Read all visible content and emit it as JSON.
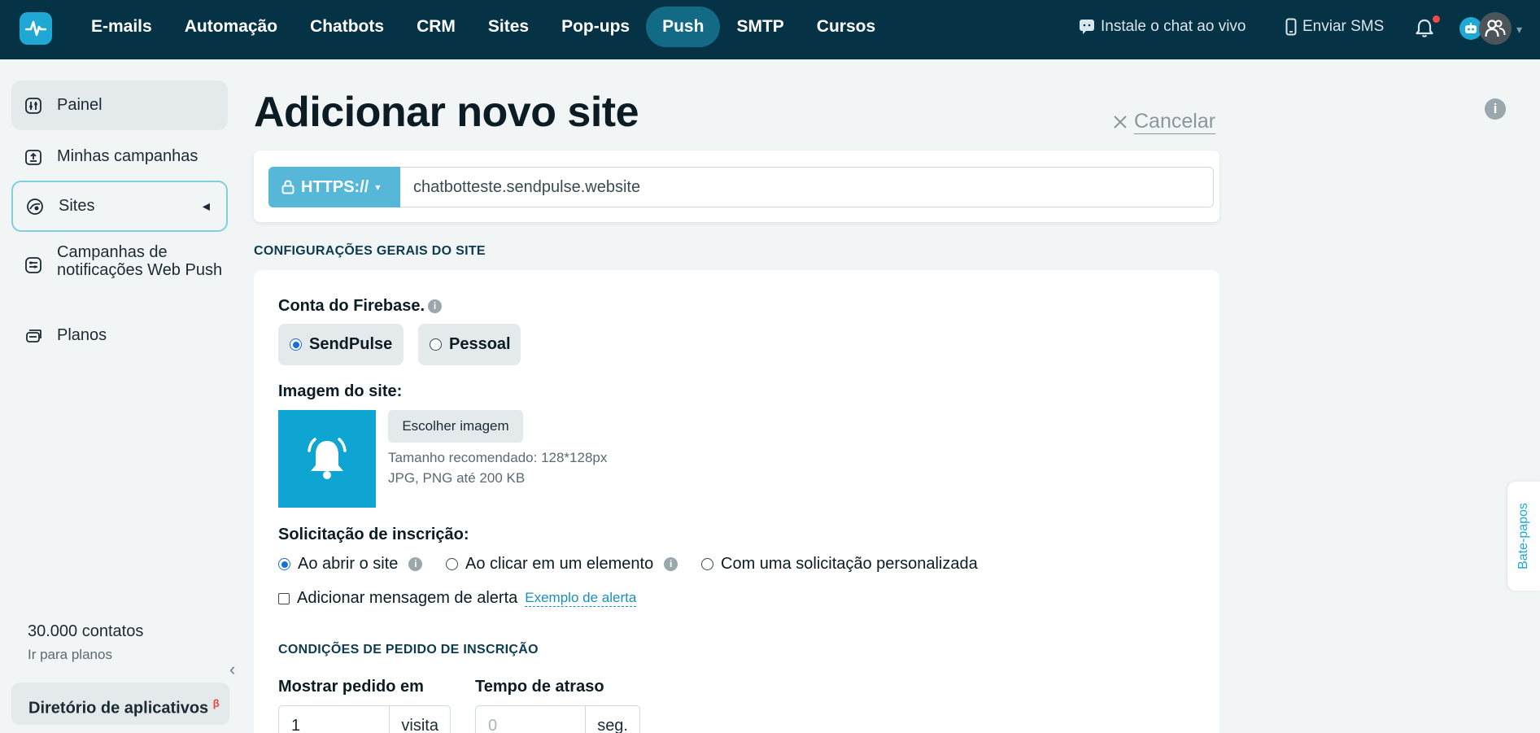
{
  "topbar": {
    "nav": [
      "E-mails",
      "Automação",
      "Chatbots",
      "CRM",
      "Sites",
      "Pop-ups",
      "Push",
      "SMTP",
      "Cursos"
    ],
    "active_nav": "Push",
    "live_chat": "Instale o chat ao vivo",
    "send_sms": "Enviar SMS"
  },
  "sidebar": {
    "items": [
      "Painel",
      "Minhas campanhas",
      "Sites",
      "Campanhas de notificações Web Push",
      "Planos"
    ],
    "contacts": "30.000 contatos",
    "go_plans": "Ir para planos",
    "app_directory": "Diretório de aplicativos",
    "app_directory_badge": "β"
  },
  "page": {
    "title": "Adicionar novo site",
    "cancel": "Cancelar"
  },
  "url": {
    "protocol": "HTTPS://",
    "value": "chatbotteste.sendpulse.website"
  },
  "settings": {
    "section_title": "CONFIGURAÇÕES GERAIS DO SITE",
    "firebase_label": "Conta do Firebase.",
    "firebase_options": [
      "SendPulse",
      "Pessoal"
    ],
    "firebase_selected": "SendPulse",
    "image_label": "Imagem do site:",
    "choose_image": "Escolher imagem",
    "image_hint_size": "Tamanho recomendado: 128*128px",
    "image_hint_format": "JPG, PNG até 200 KB",
    "subscription_label": "Solicitação de inscrição:",
    "subscription_options": [
      "Ao abrir o site",
      "Ao clicar em um elemento",
      "Com uma solicitação personalizada"
    ],
    "subscription_selected": "Ao abrir o site",
    "alert_checkbox": "Adicionar mensagem de alerta",
    "alert_example": "Exemplo de alerta",
    "conditions_title": "CONDIÇÕES DE PEDIDO DE INSCRIÇÃO",
    "show_on_label": "Mostrar pedido em",
    "show_on_value": "1",
    "show_on_unit": "visita",
    "delay_label": "Tempo de atraso",
    "delay_placeholder": "0",
    "delay_unit": "seg."
  },
  "chat_tab": "Bate-papos",
  "colors": {
    "topbar": "#063245",
    "nav_active": "#136a84",
    "accent": "#1fa8d3",
    "protocol": "#56b7d9"
  }
}
